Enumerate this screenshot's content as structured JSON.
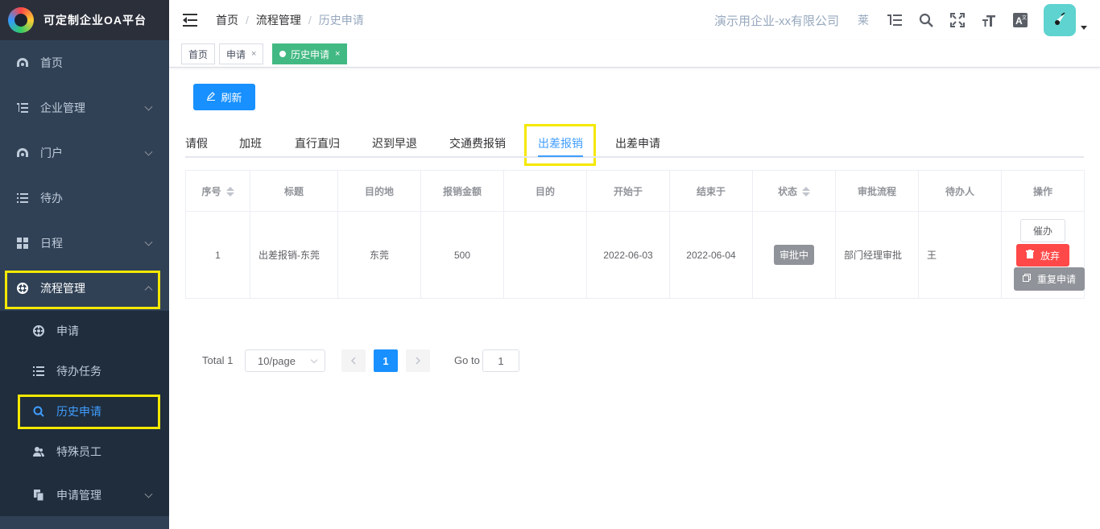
{
  "app": {
    "title": "可定制企业OA平台"
  },
  "sidebar": {
    "items": [
      {
        "label": "首页",
        "icon": "dashboard-icon"
      },
      {
        "label": "企业管理",
        "icon": "list-tree-icon"
      },
      {
        "label": "门户",
        "icon": "dashboard-icon"
      },
      {
        "label": "待办",
        "icon": "list-icon"
      },
      {
        "label": "日程",
        "icon": "grid-icon"
      },
      {
        "label": "流程管理",
        "icon": "process-icon"
      }
    ],
    "subitems": [
      {
        "label": "申请",
        "icon": "process-icon"
      },
      {
        "label": "待办任务",
        "icon": "list-icon"
      },
      {
        "label": "历史申请",
        "icon": "search-icon"
      },
      {
        "label": "特殊员工",
        "icon": "user-icon"
      },
      {
        "label": "申请管理",
        "icon": "documents-icon"
      }
    ]
  },
  "header": {
    "breadcrumb": [
      "首页",
      "流程管理",
      "历史申请"
    ],
    "company": "演示用企业-xx有限公司",
    "user_short": "莱"
  },
  "tags": [
    {
      "label": "首页"
    },
    {
      "label": "申请",
      "close": "×"
    },
    {
      "label": "历史申请",
      "close": "×"
    }
  ],
  "toolbar": {
    "refresh_label": "刷新"
  },
  "tabs": [
    "请假",
    "加班",
    "直行直归",
    "迟到早退",
    "交通费报销",
    "出差报销",
    "出差申请"
  ],
  "table": {
    "headers": [
      "序号",
      "标题",
      "目的地",
      "报销金额",
      "目的",
      "开始于",
      "结束于",
      "状态",
      "审批流程",
      "待办人",
      "操作"
    ],
    "rows": [
      {
        "index": "1",
        "title": "出差报销-东莞",
        "destination": "东莞",
        "amount": "500",
        "purpose": "",
        "start": "2022-06-03",
        "end": "2022-06-04",
        "status": "审批中",
        "flow": "部门经理审批",
        "assignee": "王",
        "ops": {
          "urge": "催办",
          "abandon": "放弃",
          "repeat": "重复申请"
        }
      }
    ]
  },
  "pagination": {
    "total_label": "Total 1",
    "page_size": "10/page",
    "current_page": "1",
    "goto_label": "Go to",
    "goto_value": "1"
  },
  "colors": {
    "sidebar_bg": "#304156",
    "primary": "#1890ff",
    "active_tag": "#42b983",
    "danger": "#ff4949",
    "highlight": "#f5e800"
  }
}
